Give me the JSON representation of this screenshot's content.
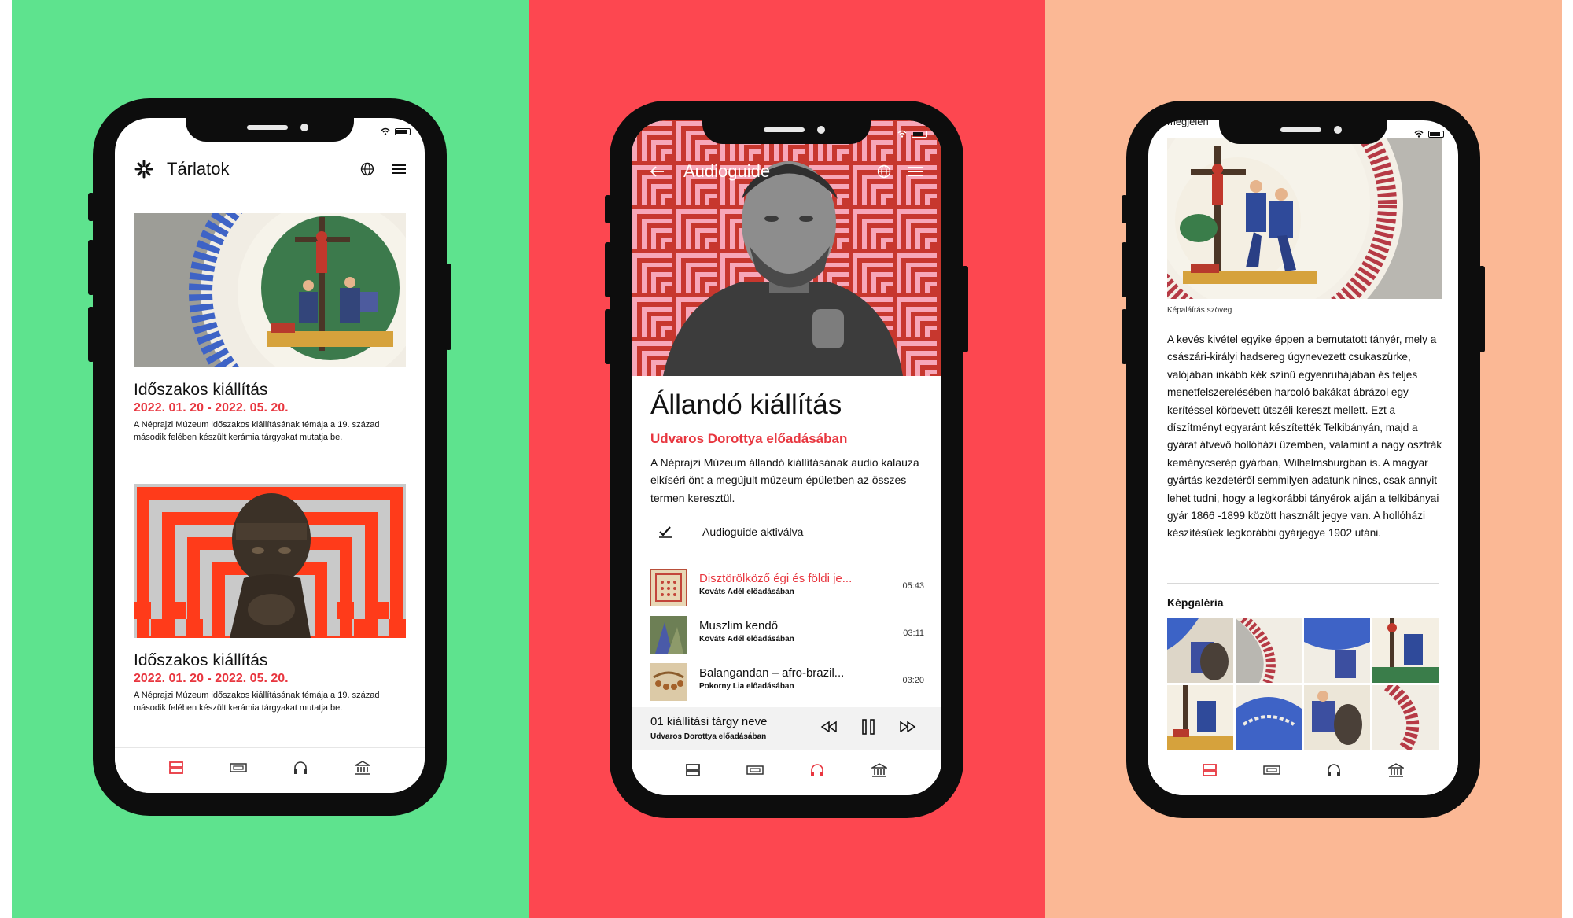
{
  "colors": {
    "green": "#5ee38e",
    "red": "#fd4750",
    "peach": "#fbb895",
    "accent": "#e8363f"
  },
  "screen1": {
    "title": "Tárlatok",
    "cards": [
      {
        "title": "Időszakos kiállítás",
        "date": "2022. 01. 20 - 2022. 05. 20.",
        "desc": "A Néprajzi Múzeum időszakos kiállításának témája a 19. század második felében készült kerámia tárgyakat mutatja be."
      },
      {
        "title": "Időszakos kiállítás",
        "date": "2022. 01. 20 - 2022. 05. 20.",
        "desc": "A Néprajzi Múzeum időszakos kiállításának témája a 19. század második felében készült kerámia tárgyakat mutatja be."
      }
    ]
  },
  "screen2": {
    "title": "Audioguide",
    "heading": "Állandó kiállítás",
    "subheading": "Udvaros Dorottya előadásában",
    "desc": "A Néprajzi Múzeum állandó kiállításának audio kalauza elkíséri önt a megújult múzeum épületben az összes termen keresztül.",
    "audioguide_status": "Audioguide aktiválva",
    "tracks": [
      {
        "title": "Disztörölköző égi és földi je...",
        "sub": "Kováts Adél előadásában",
        "time": "05:43",
        "active": true
      },
      {
        "title": "Muszlim kendő",
        "sub": "Kováts Adél előadásában",
        "time": "03:11",
        "active": false
      },
      {
        "title": "Balangandan – afro-brazil...",
        "sub": "Pokorny Lia előadásában",
        "time": "03:20",
        "active": false
      }
    ],
    "player": {
      "title": "01 kiállítási tárgy neve",
      "sub": "Udvaros Dorottya előadásában",
      "progress": 0.35
    }
  },
  "screen3": {
    "top_cut_text": "megjelen",
    "caption": "Képaláírás szöveg",
    "body": "A kevés kivétel egyike éppen a bemutatott tányér, mely a császári-királyi hadsereg úgynevezett csukaszürke, valójában inkább kék színű egyenruhájában és teljes menetfelszerelésében harcoló bakákat ábrázol egy kerítéssel körbevett útszéli kereszt mellett. Ezt a díszítményt egyaránt készítették Telkibányán, majd a gyárat átvevő hollóházi üzemben, valamint a nagy osztrák keménycserép gyárban, Wilhelmsburgban is. A magyar gyártás kezdetéről semmilyen adatunk nincs, csak annyit lehet tudni, hogy a legkorábbi tányérok alján a telkibányai gyár 1866 -1899 között használt jegye van. A hollóházi készítésűek legkorábbi gyárjegye 1902 utáni.",
    "gallery_title": "Képgaléria"
  },
  "tabs": [
    "exhibitions-icon",
    "ticket-icon",
    "headphones-icon",
    "museum-icon"
  ]
}
